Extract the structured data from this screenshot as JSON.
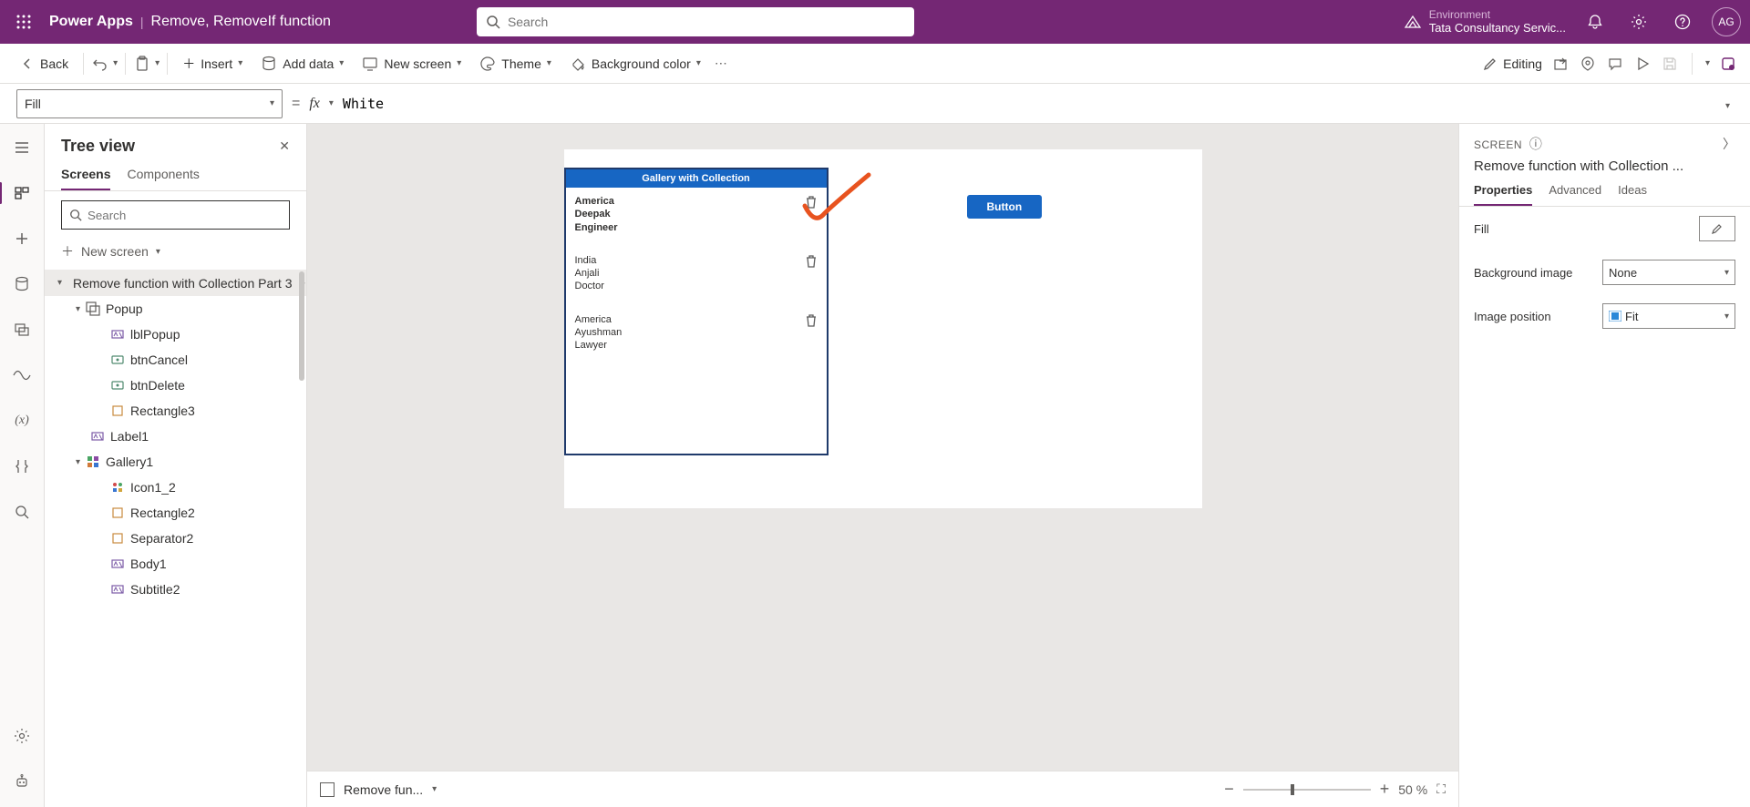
{
  "header": {
    "app": "Power Apps",
    "page": "Remove, RemoveIf function",
    "search_placeholder": "Search",
    "env_label": "Environment",
    "env_name": "Tata Consultancy Servic...",
    "avatar": "AG"
  },
  "ribbon": {
    "back": "Back",
    "insert": "Insert",
    "add_data": "Add data",
    "new_screen": "New screen",
    "theme": "Theme",
    "bg_color": "Background color",
    "editing": "Editing"
  },
  "formula": {
    "property": "Fill",
    "value": "White"
  },
  "tree": {
    "title": "Tree view",
    "tab_screens": "Screens",
    "tab_components": "Components",
    "search_placeholder": "Search",
    "new_screen": "New screen",
    "items": [
      {
        "label": "Remove function with Collection Part 3",
        "depth": 0,
        "selected": true,
        "expandable": true,
        "iconType": "screen"
      },
      {
        "label": "Popup",
        "depth": 1,
        "expandable": true,
        "iconType": "group"
      },
      {
        "label": "lblPopup",
        "depth": 2,
        "iconType": "label"
      },
      {
        "label": "btnCancel",
        "depth": 2,
        "iconType": "button"
      },
      {
        "label": "btnDelete",
        "depth": 2,
        "iconType": "button"
      },
      {
        "label": "Rectangle3",
        "depth": 2,
        "iconType": "shape"
      },
      {
        "label": "Label1",
        "depth": 1,
        "iconType": "label"
      },
      {
        "label": "Gallery1",
        "depth": 1,
        "expandable": true,
        "iconType": "gallery"
      },
      {
        "label": "Icon1_2",
        "depth": 2,
        "iconType": "iconset"
      },
      {
        "label": "Rectangle2",
        "depth": 2,
        "iconType": "shape"
      },
      {
        "label": "Separator2",
        "depth": 2,
        "iconType": "shape"
      },
      {
        "label": "Body1",
        "depth": 2,
        "iconType": "label"
      },
      {
        "label": "Subtitle2",
        "depth": 2,
        "iconType": "label"
      }
    ]
  },
  "canvas": {
    "gallery_title": "Gallery with Collection",
    "button_label": "Button",
    "rows": [
      {
        "country": "America",
        "name": "Deepak",
        "job": "Engineer",
        "bold": true
      },
      {
        "country": "India",
        "name": "Anjali",
        "job": "Doctor",
        "bold": false
      },
      {
        "country": "America",
        "name": "Ayushman",
        "job": "Lawyer",
        "bold": false
      }
    ]
  },
  "footer": {
    "breadcrumb": "Remove fun...",
    "zoom": "50  %"
  },
  "right": {
    "section": "SCREEN",
    "name": "Remove function with Collection ...",
    "tab_props": "Properties",
    "tab_adv": "Advanced",
    "tab_ideas": "Ideas",
    "fill_label": "Fill",
    "bgimg_label": "Background image",
    "bgimg_value": "None",
    "imgpos_label": "Image position",
    "imgpos_value": "Fit"
  }
}
